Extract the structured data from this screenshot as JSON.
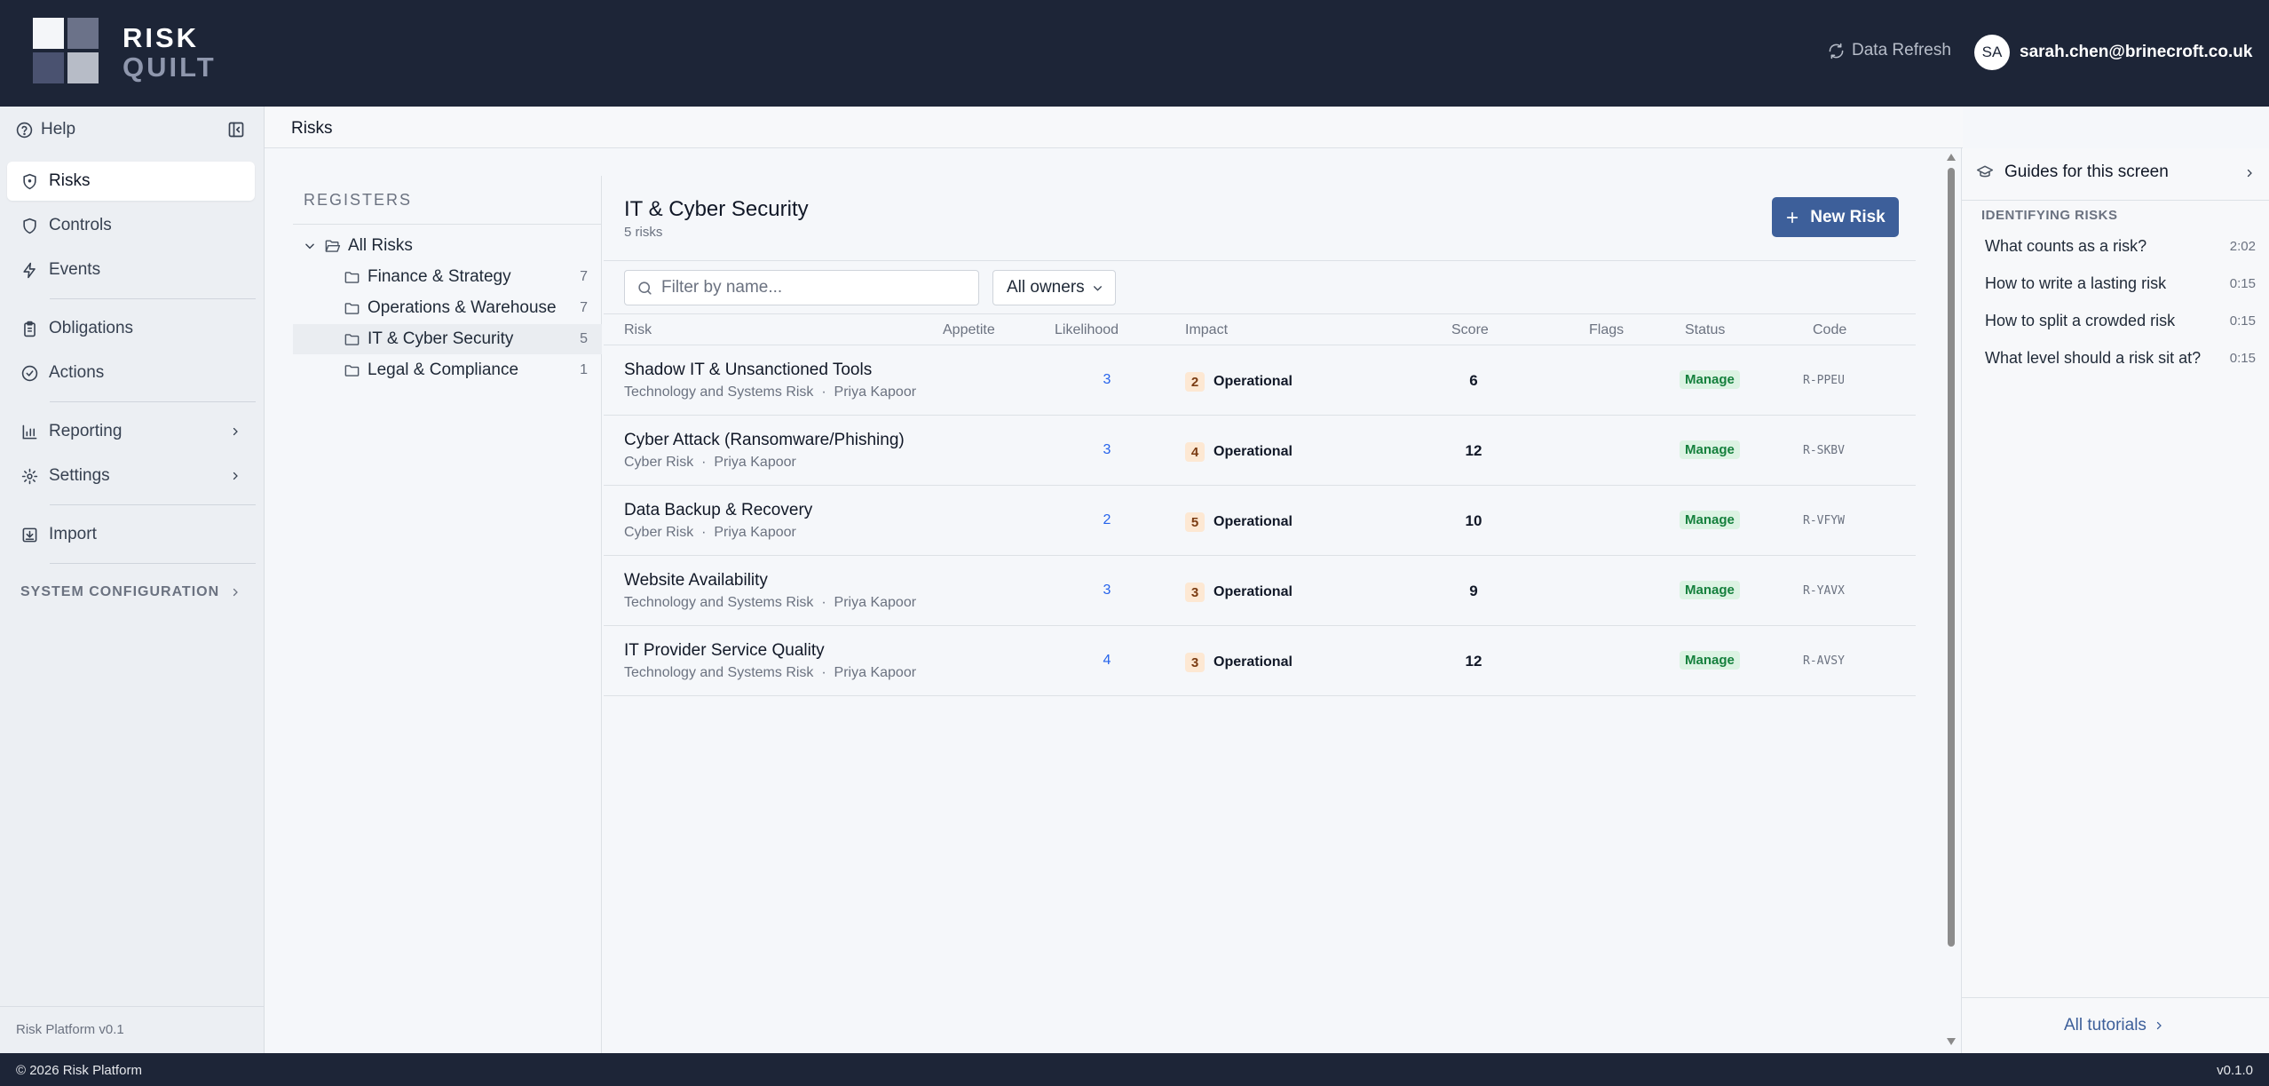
{
  "app": {
    "logo_line1": "RISK",
    "logo_line2": "QUILT",
    "data_refresh": "Data Refresh",
    "avatar_initials": "SA",
    "user_email": "sarah.chen@brinecroft.co.uk",
    "colors": {
      "header_bg": "#1d2537",
      "accent": "#3d5f9a",
      "status_green": "#15803d"
    }
  },
  "sidebar": {
    "help": "Help",
    "items": [
      {
        "label": "Risks",
        "icon": "shield-icon"
      },
      {
        "label": "Controls",
        "icon": "shield-outline-icon"
      },
      {
        "label": "Events",
        "icon": "lightning-icon"
      },
      {
        "label": "Obligations",
        "icon": "clipboard-icon"
      },
      {
        "label": "Actions",
        "icon": "check-circle-icon"
      },
      {
        "label": "Reporting",
        "icon": "bar-chart-icon"
      },
      {
        "label": "Settings",
        "icon": "gear-icon"
      },
      {
        "label": "Import",
        "icon": "import-icon"
      }
    ],
    "system_configuration": "SYSTEM CONFIGURATION",
    "version": "Risk Platform v0.1"
  },
  "page": {
    "breadcrumb": "Risks"
  },
  "registers": {
    "title": "REGISTERS",
    "root": "All Risks",
    "items": [
      {
        "label": "Finance & Strategy",
        "count": "7"
      },
      {
        "label": "Operations & Warehouse",
        "count": "7"
      },
      {
        "label": "IT & Cyber Security",
        "count": "5"
      },
      {
        "label": "Legal & Compliance",
        "count": "1"
      }
    ]
  },
  "main": {
    "title": "IT & Cyber Security",
    "subtitle": "5 risks",
    "new_risk": "New Risk",
    "filter_placeholder": "Filter by name...",
    "owners_filter": "All owners",
    "columns": [
      "Risk",
      "Appetite",
      "Likelihood",
      "Impact",
      "Score",
      "Flags",
      "Status",
      "Code"
    ],
    "rows": [
      {
        "name": "Shadow IT & Unsanctioned Tools",
        "category": "Technology and Systems Risk",
        "owner": "Priya Kapoor",
        "likelihood": "3",
        "impact_score": "2",
        "impact_label": "Operational",
        "score": "6",
        "status": "Manage",
        "code": "R-PPEU"
      },
      {
        "name": "Cyber Attack (Ransomware/Phishing)",
        "category": "Cyber Risk",
        "owner": "Priya Kapoor",
        "likelihood": "3",
        "impact_score": "4",
        "impact_label": "Operational",
        "score": "12",
        "status": "Manage",
        "code": "R-SKBV"
      },
      {
        "name": "Data Backup & Recovery",
        "category": "Cyber Risk",
        "owner": "Priya Kapoor",
        "likelihood": "2",
        "impact_score": "5",
        "impact_label": "Operational",
        "score": "10",
        "status": "Manage",
        "code": "R-VFYW"
      },
      {
        "name": "Website Availability",
        "category": "Technology and Systems Risk",
        "owner": "Priya Kapoor",
        "likelihood": "3",
        "impact_score": "3",
        "impact_label": "Operational",
        "score": "9",
        "status": "Manage",
        "code": "R-YAVX"
      },
      {
        "name": "IT Provider Service Quality",
        "category": "Technology and Systems Risk",
        "owner": "Priya Kapoor",
        "likelihood": "4",
        "impact_score": "3",
        "impact_label": "Operational",
        "score": "12",
        "status": "Manage",
        "code": "R-AVSY"
      }
    ],
    "meta_separator": "·"
  },
  "guides": {
    "title": "Guides for this screen",
    "section": "IDENTIFYING RISKS",
    "items": [
      {
        "label": "What counts as a risk?",
        "duration": "2:02"
      },
      {
        "label": "How to write a lasting risk",
        "duration": "0:15"
      },
      {
        "label": "How to split a crowded risk",
        "duration": "0:15"
      },
      {
        "label": "What level should a risk sit at?",
        "duration": "0:15"
      }
    ],
    "all_tutorials": "All tutorials"
  },
  "footer": {
    "copyright": "© 2026 Risk Platform",
    "version": "v0.1.0"
  }
}
